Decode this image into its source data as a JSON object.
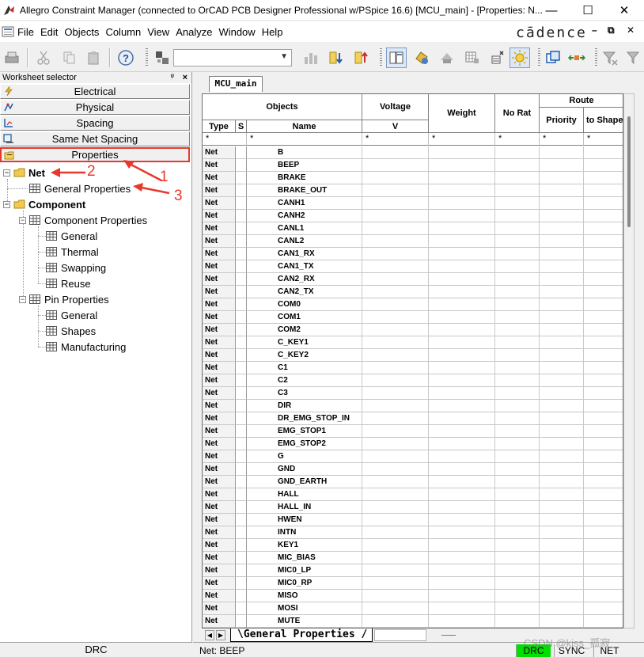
{
  "window": {
    "title": "Allegro Constraint Manager (connected to OrCAD PCB Designer Professional w/PSpice 16.6) [MCU_main] - [Properties:  N...",
    "controls": [
      "—",
      "☐",
      "✕"
    ]
  },
  "menubar": {
    "items": [
      "File",
      "Edit",
      "Objects",
      "Column",
      "View",
      "Analyze",
      "Window",
      "Help"
    ],
    "brand": "cādence",
    "mdi_controls": [
      "–",
      "⧉",
      "✕"
    ]
  },
  "toolbar": {
    "combo_value": ""
  },
  "worksheet_selector": {
    "title": "Worksheet selector",
    "pin": "ᵠ",
    "close": "×",
    "buttons": [
      "Electrical",
      "Physical",
      "Spacing",
      "Same Net Spacing",
      "Properties"
    ],
    "active_button": "Properties"
  },
  "tree": {
    "net": "Net",
    "general_properties": "General Properties",
    "component": "Component",
    "component_properties": "Component Properties",
    "cp_general": "General",
    "cp_thermal": "Thermal",
    "cp_swapping": "Swapping",
    "cp_reuse": "Reuse",
    "pin_properties": "Pin Properties",
    "pp_general": "General",
    "pp_shapes": "Shapes",
    "pp_manufacturing": "Manufacturing"
  },
  "annotations": {
    "n1": "1",
    "n2": "2",
    "n3": "3",
    "color": "#e8382c"
  },
  "bottom_left_tab": "DRC",
  "doc_tab": "MCU_main",
  "grid": {
    "headers": {
      "objects": "Objects",
      "type": "Type",
      "s": "S",
      "name": "Name",
      "voltage": "Voltage",
      "voltage_unit": "V",
      "weight": "Weight",
      "no_rat": "No Rat",
      "route": "Route",
      "priority": "Priority",
      "to_shape": "to Shape"
    },
    "filter": {
      "type": "*",
      "name": "*",
      "voltage": "*",
      "weight": "*",
      "norat": "*",
      "priority": "*",
      "toshape": "*"
    },
    "rows": [
      {
        "type": "Net",
        "name": "B"
      },
      {
        "type": "Net",
        "name": "BEEP"
      },
      {
        "type": "Net",
        "name": "BRAKE"
      },
      {
        "type": "Net",
        "name": "BRAKE_OUT"
      },
      {
        "type": "Net",
        "name": "CANH1"
      },
      {
        "type": "Net",
        "name": "CANH2"
      },
      {
        "type": "Net",
        "name": "CANL1"
      },
      {
        "type": "Net",
        "name": "CANL2"
      },
      {
        "type": "Net",
        "name": "CAN1_RX"
      },
      {
        "type": "Net",
        "name": "CAN1_TX"
      },
      {
        "type": "Net",
        "name": "CAN2_RX"
      },
      {
        "type": "Net",
        "name": "CAN2_TX"
      },
      {
        "type": "Net",
        "name": "COM0"
      },
      {
        "type": "Net",
        "name": "COM1"
      },
      {
        "type": "Net",
        "name": "COM2"
      },
      {
        "type": "Net",
        "name": "C_KEY1"
      },
      {
        "type": "Net",
        "name": "C_KEY2"
      },
      {
        "type": "Net",
        "name": "C1"
      },
      {
        "type": "Net",
        "name": "C2"
      },
      {
        "type": "Net",
        "name": "C3"
      },
      {
        "type": "Net",
        "name": "DIR"
      },
      {
        "type": "Net",
        "name": "DR_EMG_STOP_IN"
      },
      {
        "type": "Net",
        "name": "EMG_STOP1"
      },
      {
        "type": "Net",
        "name": "EMG_STOP2"
      },
      {
        "type": "Net",
        "name": "G"
      },
      {
        "type": "Net",
        "name": "GND"
      },
      {
        "type": "Net",
        "name": "GND_EARTH"
      },
      {
        "type": "Net",
        "name": "HALL"
      },
      {
        "type": "Net",
        "name": "HALL_IN"
      },
      {
        "type": "Net",
        "name": "HWEN"
      },
      {
        "type": "Net",
        "name": "INTN"
      },
      {
        "type": "Net",
        "name": "KEY1"
      },
      {
        "type": "Net",
        "name": "MIC_BIAS"
      },
      {
        "type": "Net",
        "name": "MIC0_LP"
      },
      {
        "type": "Net",
        "name": "MIC0_RP"
      },
      {
        "type": "Net",
        "name": "MISO"
      },
      {
        "type": "Net",
        "name": "MOSI"
      },
      {
        "type": "Net",
        "name": "MUTE"
      }
    ]
  },
  "sheet_tab": "\\General Properties /",
  "status": {
    "text": "Net: BEEP",
    "drc": "DRC",
    "sync": "SYNC",
    "net": "NET"
  },
  "watermark": "CSDN @kiss_孤寂"
}
